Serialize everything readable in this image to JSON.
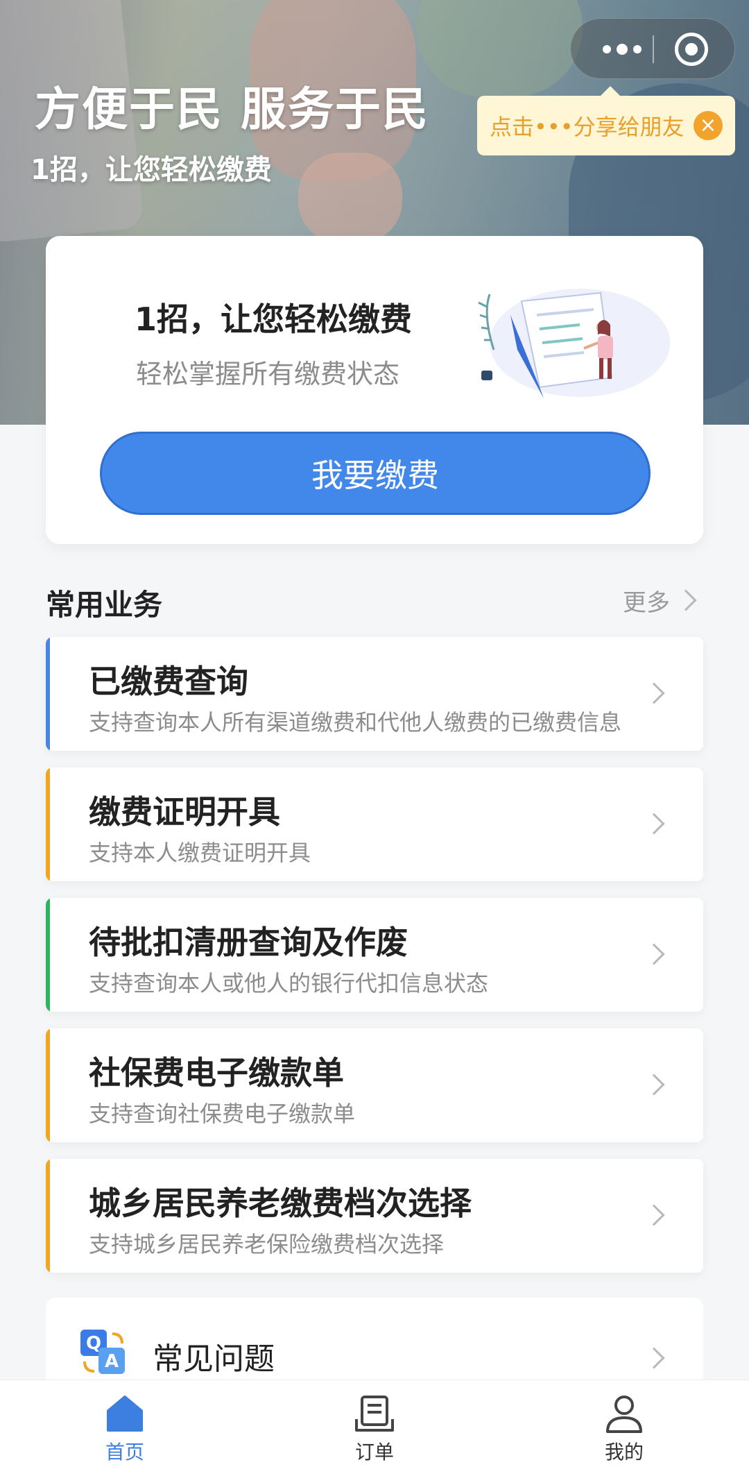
{
  "hero": {
    "title": "方便于民 服务于民",
    "subtitle": "1招，让您轻松缴费"
  },
  "share_tip": {
    "text": "点击•••分享给朋友",
    "close": "×"
  },
  "pay_card": {
    "title": "1招，让您轻松缴费",
    "subtitle": "轻松掌握所有缴费状态",
    "button_label": "我要缴费"
  },
  "section": {
    "title": "常用业务",
    "more_label": "更多"
  },
  "services": [
    {
      "title": "已缴费查询",
      "desc": "支持查询本人所有渠道缴费和代他人缴费的已缴费信息",
      "accent": "#4a86e0"
    },
    {
      "title": "缴费证明开具",
      "desc": "支持本人缴费证明开具",
      "accent": "#f0a623"
    },
    {
      "title": "待批扣清册查询及作废",
      "desc": "支持查询本人或他人的银行代扣信息状态",
      "accent": "#2db55d"
    },
    {
      "title": "社保费电子缴款单",
      "desc": "支持查询社保费电子缴款单",
      "accent": "#f0a623"
    },
    {
      "title": "城乡居民养老缴费档次选择",
      "desc": "支持城乡居民养老保险缴费档次选择",
      "accent": "#f0a623"
    }
  ],
  "faq": {
    "label": "常见问题",
    "icon": "qa-icon"
  },
  "tabbar": {
    "items": [
      {
        "label": "首页",
        "icon": "home-icon",
        "active": true
      },
      {
        "label": "订单",
        "icon": "order-icon",
        "active": false
      },
      {
        "label": "我的",
        "icon": "user-icon",
        "active": false
      }
    ]
  },
  "colors": {
    "primary": "#4288ea",
    "tip_background": "#fff6d6",
    "tip_text": "#e9a02a",
    "page_background": "#f5f6f8"
  }
}
